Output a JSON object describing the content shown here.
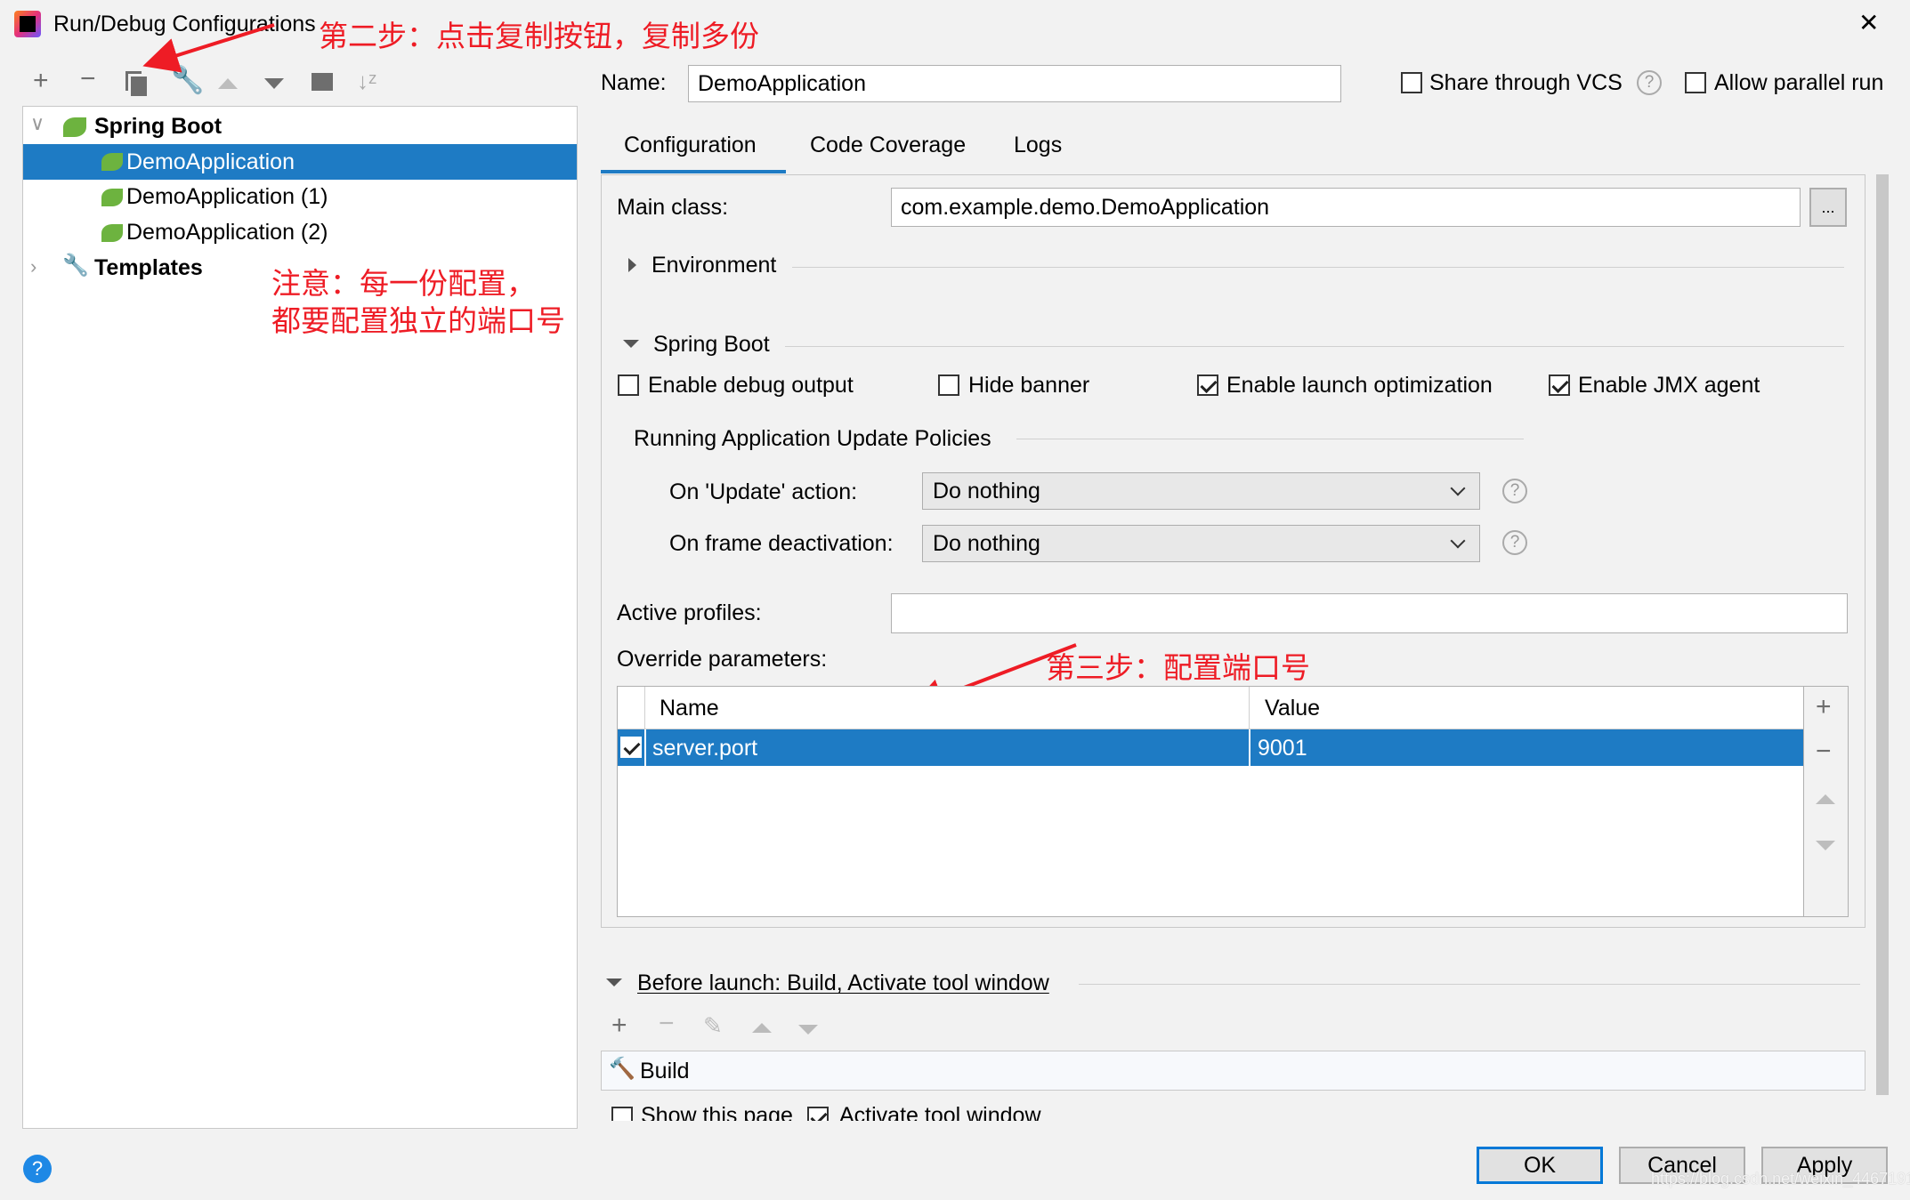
{
  "window": {
    "title": "Run/Debug Configurations",
    "close": "✕"
  },
  "annotations": {
    "step2": "第二步：点击复制按钮，复制多份",
    "note_line1": "注意：每一份配置，",
    "note_line2": "都要配置独立的端口号",
    "step3": "第三步：配置端口号"
  },
  "toolbar": {
    "icons": [
      "add-icon",
      "remove-icon",
      "copy-icon",
      "wrench-icon",
      "move-up-icon",
      "move-down-icon",
      "new-folder-icon",
      "sort-icon"
    ]
  },
  "tree": {
    "group": "Spring Boot",
    "items": [
      "DemoApplication",
      "DemoApplication (1)",
      "DemoApplication (2)"
    ],
    "selected": "DemoApplication",
    "templates": "Templates"
  },
  "header": {
    "name_label": "Name:",
    "name_value": "DemoApplication",
    "share_vcs": "Share through VCS",
    "share_vcs_checked": false,
    "allow_parallel": "Allow parallel run",
    "allow_parallel_checked": false
  },
  "tabs": [
    "Configuration",
    "Code Coverage",
    "Logs"
  ],
  "active_tab": "Configuration",
  "config": {
    "main_class_label": "Main class:",
    "main_class_value": "com.example.demo.DemoApplication",
    "browse": "...",
    "environment": "Environment",
    "spring_boot": "Spring Boot",
    "checkboxes": [
      {
        "label": "Enable debug output",
        "checked": false
      },
      {
        "label": "Hide banner",
        "checked": false
      },
      {
        "label": "Enable launch optimization",
        "checked": true
      },
      {
        "label": "Enable JMX agent",
        "checked": true
      }
    ],
    "policies_title": "Running Application Update Policies",
    "update_label": "On 'Update' action:",
    "update_value": "Do nothing",
    "frame_label": "On frame deactivation:",
    "frame_value": "Do nothing",
    "help": "?",
    "active_profiles_label": "Active profiles:",
    "active_profiles_value": "",
    "override_label": "Override parameters:",
    "table": {
      "columns": [
        "Name",
        "Value"
      ],
      "rows": [
        {
          "checked": true,
          "name": "server.port",
          "value": "9001"
        }
      ]
    }
  },
  "before_launch": {
    "title": "Before launch: Build, Activate tool window",
    "items": [
      "Build"
    ],
    "show_page": "Show this page",
    "show_page_checked": false,
    "activate": "Activate tool window",
    "activate_checked": true
  },
  "footer": {
    "ok": "OK",
    "cancel": "Cancel",
    "apply": "Apply",
    "help": "?",
    "watermark": "https://blog.csdn.net/weixin_44671911"
  },
  "colors": {
    "selection": "#1e7bc4",
    "annotation": "#ee1c25",
    "focus": "#0078d7"
  }
}
